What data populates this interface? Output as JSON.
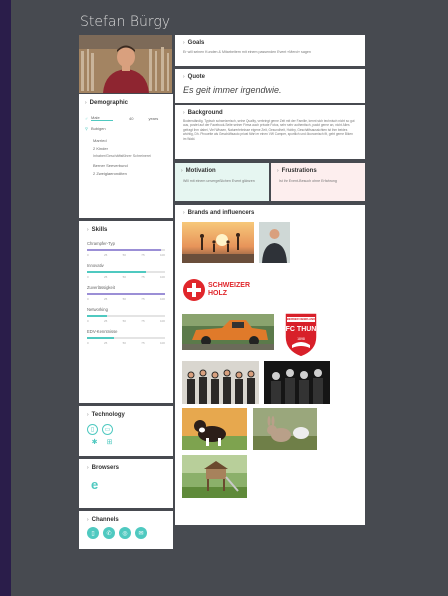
{
  "persona": {
    "name": "Stefan Bürgy"
  },
  "demographic": {
    "title": "Demographic",
    "gender": "Male",
    "age_value": "40",
    "age_unit": "years",
    "location": "Bubigen",
    "items": [
      "Married",
      "2 Kinder",
      "Inhaber/Geschäftsführer Schreinerei",
      "Berner Seeverbund",
      "2 Zweiglaeronditen"
    ]
  },
  "skills": {
    "title": "Skills",
    "ticks": [
      "0",
      "25",
      "50",
      "75",
      "100"
    ],
    "items": [
      {
        "label": "Chrampfer-Typ",
        "value": 95,
        "color": "#9b8fd6"
      },
      {
        "label": "Innovativ",
        "value": 75,
        "color": "#4fc9c0"
      },
      {
        "label": "Zuverlässigkeit",
        "value": 100,
        "color": "#9b8fd6"
      },
      {
        "label": "Networking",
        "value": 25,
        "color": "#4fc9c0"
      },
      {
        "label": "EDV-Kenntnisse",
        "value": 35,
        "color": "#4fc9c0"
      }
    ]
  },
  "technology": {
    "title": "Technology"
  },
  "browsers": {
    "title": "Browsers"
  },
  "channels": {
    "title": "Channels"
  },
  "goals": {
    "title": "Goals",
    "text": "Er will seinen Kunden & Mitarbeitern mit einem passenden Event «Merci» sagen"
  },
  "quote": {
    "title": "Quote",
    "text": "Es geit immer irgendwie."
  },
  "background": {
    "title": "Background",
    "text": "Bodenständig. Typisch schweizerisch, seine Quality, verbringt gerne Zeit mit der Familie, kennt sich technisch nicht so gut aus, postet auf der Facebook-Seite seiner Firma auch private Fotos, sehr sehr authentisch, packt gerne an, nicht Alles gefragt ihm dabei, Viel Wissen, Naturerlebnisse eigene Zeit, Gesundheit, Hobby, Geschäftsaussichten ist ihm beides wichtig, Dh. Pirouette als Geschäftsauto privat fährt er einen VW Camper, sportlich und ökonomisch fit, geht gerne Biken im Wald."
  },
  "motivation": {
    "title": "Motivation",
    "text": "Will mit einem unvergeßlichen Event glänzen"
  },
  "frustrations": {
    "title": "Frustrations",
    "text": "Ist ihr Event-Besuch ohne Erfahrung"
  },
  "brands": {
    "title": "Brands and influencers",
    "schweizer_holz_line1": "SCHWEIZER",
    "schweizer_holz_line2": "HOLZ",
    "fcthun_top": "BERNER OBERLAND",
    "fcthun_name": "FC THUN",
    "fcthun_year": "1898"
  },
  "colors": {
    "teal": "#4fc9c0",
    "purple": "#9b8fd6",
    "motivation_bg": "#e6f6f1",
    "frustration_bg": "#fdeeee"
  }
}
